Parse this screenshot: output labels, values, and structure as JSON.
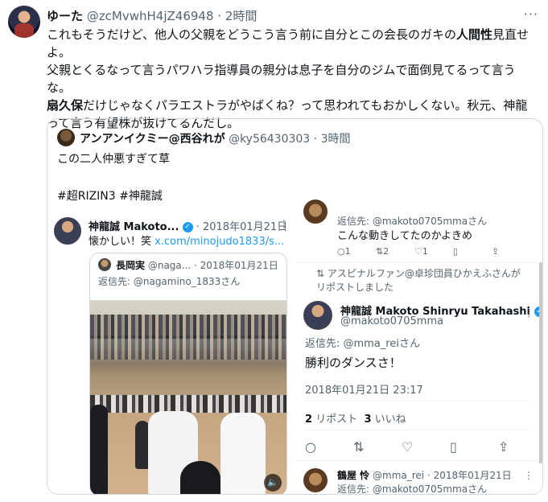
{
  "post": {
    "display_name": "ゆーた",
    "handle": "@zcMvwhH4jZ46948",
    "time": "· 2時間",
    "more": "···",
    "line1_a": "これもそうだけど、他人の父親をどうこう言う前に自分とこの会長のガキの",
    "line1_bold": "人間性",
    "line1_b": "見直せよ。",
    "line2": "父親とくるなって言うパワハラ指導員の親分は息子を自分のジムで面倒見てるって言うな。",
    "line3_bold": "扇久保",
    "line3_rest": "だけじゃなくパラエストラがやばくね？って思われてもおかしくない。秋元、神龍って言う有望株が抜けてるんだし。"
  },
  "quote": {
    "display_name": "アンアンイクミー@西谷れが",
    "handle": "@ky56430303",
    "time": "· 3時間",
    "text": "この二人仲悪すぎて草",
    "tags": "#超RIZIN3  #神龍誠"
  },
  "shot_left": {
    "display_name": "神龍誠 Makoto...",
    "verified_mark": "✓",
    "date": "· 2018年01月21日",
    "more": "⋮",
    "text_prefix": "懐かしい！笑 ",
    "link": "x.com/minojudo1833/s...",
    "inner": {
      "display_name": "長岡実",
      "handle": "@naga...",
      "date": "· 2018年01月21日",
      "reply": "返信先: @nagamino_1833さん"
    },
    "mute_icon": "🔈"
  },
  "shot_right": {
    "reply1": "返信先: @makoto0705mmaさん",
    "text1": "こんな動きしてたのかよきめ",
    "actions1": [
      "○1",
      "⇅2",
      "♡1",
      "▯",
      "⇪"
    ],
    "repost_note": "アスピナルファン@卓珍団員ひかえふさんがリポストしました",
    "name2": "神龍誠 Makoto Shinryu Takahashi",
    "verified_mark": "✓",
    "handle2": "@makoto0705mma",
    "more": "⋮",
    "reply2": "返信先: @mma_reiさん",
    "text2": "勝利のダンスさ！",
    "timestamp": "2018年01月21日 23:17",
    "stats_reposts_count": "2",
    "stats_reposts_label": "リポスト",
    "stats_likes_count": "3",
    "stats_likes_label": "いいね",
    "actions2": [
      "○",
      "⇅",
      "♡",
      "▯",
      "⇪"
    ],
    "header3_name": "鶴屋 怜",
    "header3_meta": "@mma_rei · 2018年01月21日",
    "reply3": "返信先: @makoto0705mmaさん"
  }
}
